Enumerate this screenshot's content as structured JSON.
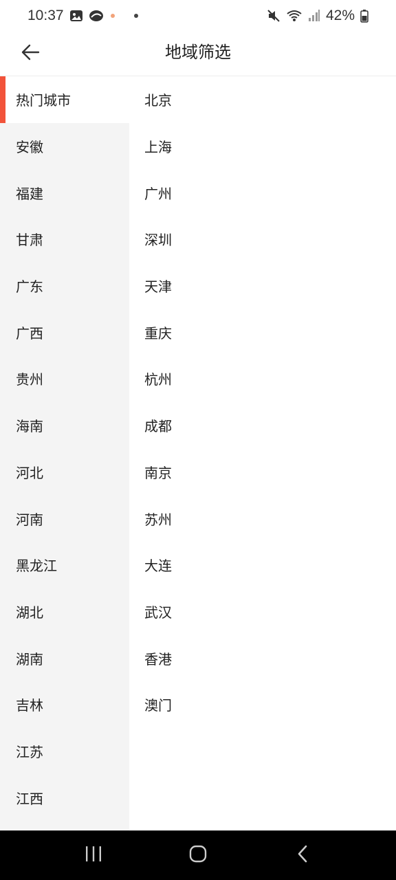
{
  "status_bar": {
    "time": "10:37",
    "battery": "42%",
    "icons": [
      "gallery-icon",
      "app-icon",
      "notification-dot-icon",
      "mute-icon",
      "wifi-icon",
      "signal-icon",
      "battery-icon"
    ]
  },
  "header": {
    "title": "地域筛选",
    "back_icon": "back-arrow-icon"
  },
  "provinces": [
    {
      "label": "热门城市",
      "active": true
    },
    {
      "label": "安徽"
    },
    {
      "label": "福建"
    },
    {
      "label": "甘肃"
    },
    {
      "label": "广东"
    },
    {
      "label": "广西"
    },
    {
      "label": "贵州"
    },
    {
      "label": "海南"
    },
    {
      "label": "河北"
    },
    {
      "label": "河南"
    },
    {
      "label": "黑龙江"
    },
    {
      "label": "湖北"
    },
    {
      "label": "湖南"
    },
    {
      "label": "吉林"
    },
    {
      "label": "江苏"
    },
    {
      "label": "江西"
    }
  ],
  "cities": [
    {
      "label": "北京"
    },
    {
      "label": "上海"
    },
    {
      "label": "广州"
    },
    {
      "label": "深圳"
    },
    {
      "label": "天津"
    },
    {
      "label": "重庆"
    },
    {
      "label": "杭州"
    },
    {
      "label": "成都"
    },
    {
      "label": "南京"
    },
    {
      "label": "苏州"
    },
    {
      "label": "大连"
    },
    {
      "label": "武汉"
    },
    {
      "label": "香港"
    },
    {
      "label": "澳门"
    }
  ],
  "colors": {
    "accent": "#f2533a",
    "sidebar_bg": "#f4f4f4",
    "nav_bg": "#000000"
  },
  "nav_bar": {
    "icons": [
      "recent-apps-icon",
      "home-icon",
      "back-icon"
    ]
  }
}
